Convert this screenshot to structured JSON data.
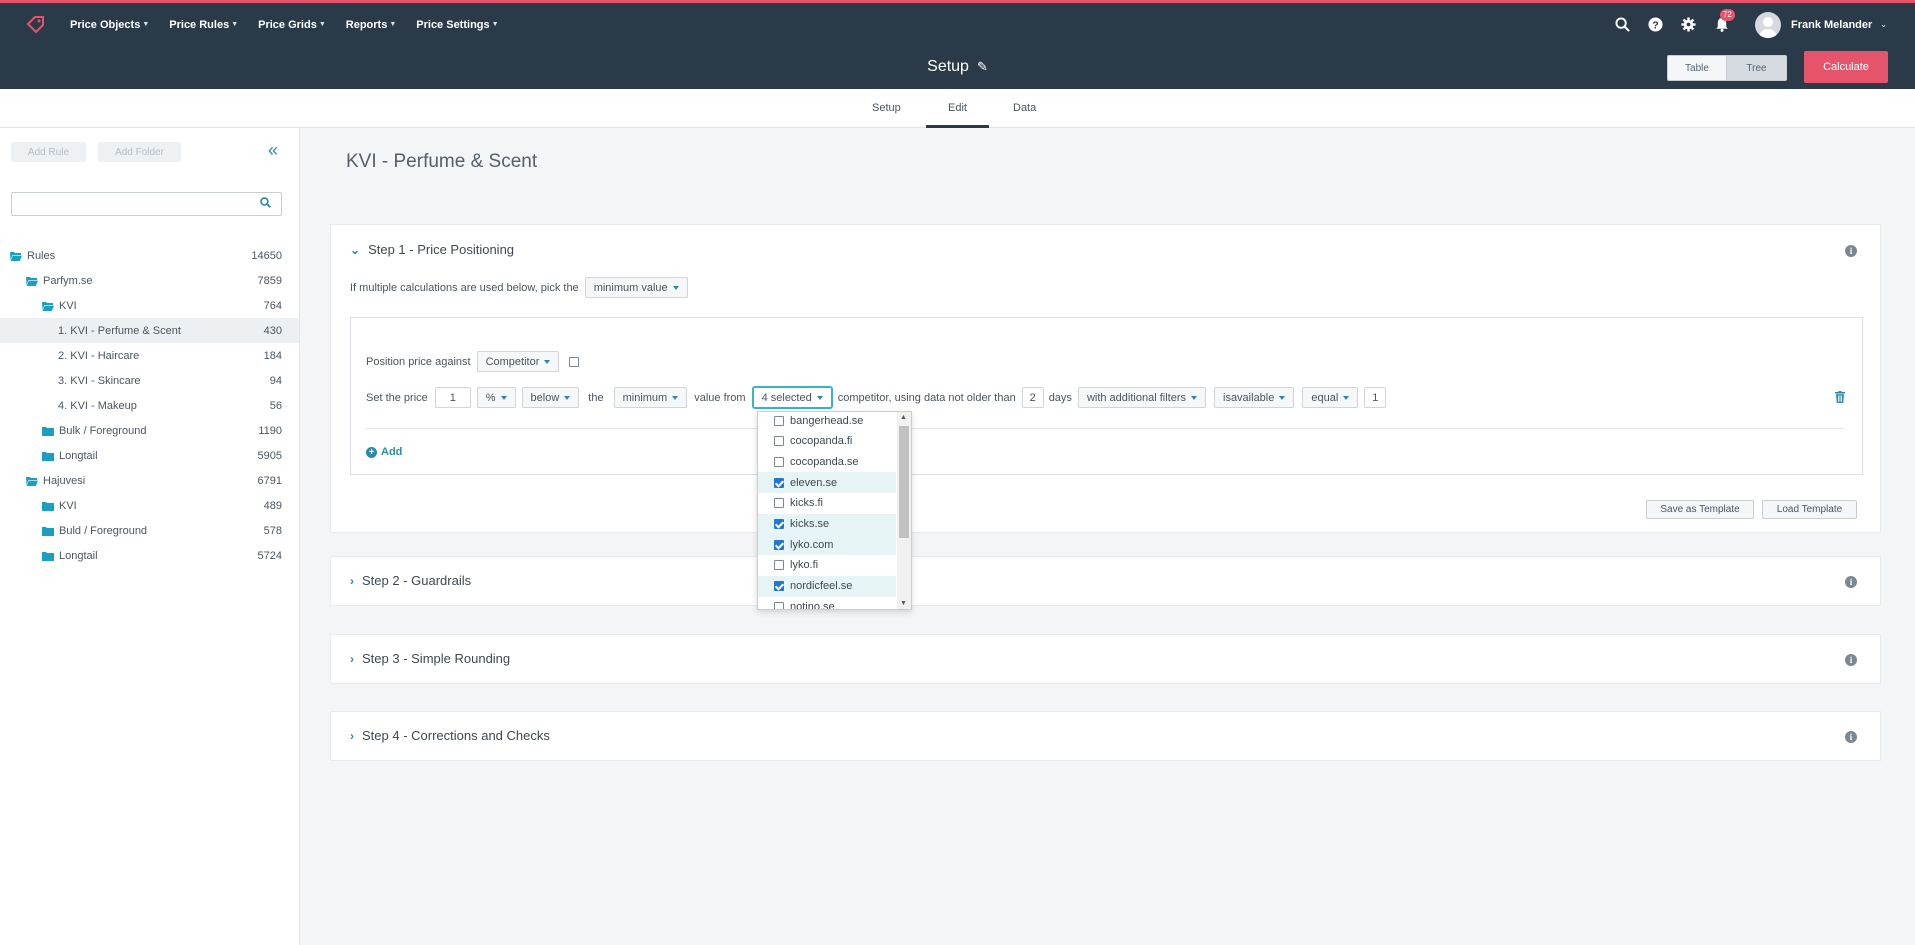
{
  "nav": {
    "menu": [
      {
        "label": "Price Objects"
      },
      {
        "label": "Price Rules"
      },
      {
        "label": "Price Grids"
      },
      {
        "label": "Reports"
      },
      {
        "label": "Price Settings"
      }
    ],
    "notification_count": "72",
    "user_name": "Frank Melander",
    "icons": [
      "logo-tag-icon",
      "search-icon",
      "help-icon",
      "gear-icon",
      "bell-icon",
      "avatar"
    ]
  },
  "titlebar": {
    "title": "Setup",
    "table_label": "Table",
    "tree_label": "Tree",
    "calculate_label": "Calculate"
  },
  "tabs": [
    {
      "label": "Setup"
    },
    {
      "label": "Edit",
      "active": true
    },
    {
      "label": "Data"
    }
  ],
  "sidebar": {
    "add_rule_label": "Add Rule",
    "add_folder_label": "Add Folder",
    "search_placeholder": "",
    "tree": [
      {
        "label": "Rules",
        "count": "14650",
        "level": 0,
        "type": "folder-open"
      },
      {
        "label": "Parfym.se",
        "count": "7859",
        "level": 1,
        "type": "folder-open"
      },
      {
        "label": "KVI",
        "count": "764",
        "level": 2,
        "type": "folder-open"
      },
      {
        "label": "1. KVI - Perfume & Scent",
        "count": "430",
        "level": 3,
        "type": "rule",
        "selected": true
      },
      {
        "label": "2. KVI - Haircare",
        "count": "184",
        "level": 3,
        "type": "rule"
      },
      {
        "label": "3. KVI - Skincare",
        "count": "94",
        "level": 3,
        "type": "rule"
      },
      {
        "label": "4. KVI - Makeup",
        "count": "56",
        "level": 3,
        "type": "rule"
      },
      {
        "label": "Bulk / Foreground",
        "count": "1190",
        "level": 2,
        "type": "folder"
      },
      {
        "label": "Longtail",
        "count": "5905",
        "level": 2,
        "type": "folder"
      },
      {
        "label": "Hajuvesi",
        "count": "6791",
        "level": 1,
        "type": "folder-open"
      },
      {
        "label": "KVI",
        "count": "489",
        "level": 2,
        "type": "folder"
      },
      {
        "label": "Buld / Foreground",
        "count": "578",
        "level": 2,
        "type": "folder"
      },
      {
        "label": "Longtail",
        "count": "5724",
        "level": 2,
        "type": "folder"
      }
    ]
  },
  "main": {
    "rule_title": "KVI - Perfume & Scent",
    "step1": {
      "title": "Step 1 - Price Positioning",
      "multiple_calc_text": "If multiple calculations are used below, pick the",
      "multiple_calc_value": "minimum value",
      "position_label": "Position price against",
      "position_value": "Competitor",
      "set_price_label": "Set the price",
      "amount": "1",
      "unit": "%",
      "direction": "below",
      "the_label": "the",
      "agg": "minimum",
      "value_from_label": "value from",
      "competitors_selected": "4 selected",
      "competitor_text": "competitor, using data not older than",
      "days_value": "2",
      "days_label": "days",
      "filter_mode": "with additional filters",
      "filter_field": "isavailable",
      "filter_op": "equal",
      "filter_value": "1",
      "add_label": "Add",
      "save_template_label": "Save as Template",
      "load_template_label": "Load Template"
    },
    "step2": {
      "title": "Step 2 - Guardrails"
    },
    "step3": {
      "title": "Step 3 - Simple Rounding"
    },
    "step4": {
      "title": "Step 4 - Corrections and Checks"
    }
  },
  "competitor_dropdown": [
    {
      "label": "bangerhead.se",
      "checked": false
    },
    {
      "label": "cocopanda.fi",
      "checked": false
    },
    {
      "label": "cocopanda.se",
      "checked": false
    },
    {
      "label": "eleven.se",
      "checked": true
    },
    {
      "label": "kicks.fi",
      "checked": false
    },
    {
      "label": "kicks.se",
      "checked": true
    },
    {
      "label": "lyko.com",
      "checked": true
    },
    {
      "label": "lyko.fi",
      "checked": false
    },
    {
      "label": "nordicfeel.se",
      "checked": true
    },
    {
      "label": "notino.se",
      "checked": false
    }
  ],
  "colors": {
    "nav_bg": "#2b3a49",
    "accent": "#e5546a",
    "link": "#2e8aa8",
    "folder": "#1a9fc0"
  }
}
